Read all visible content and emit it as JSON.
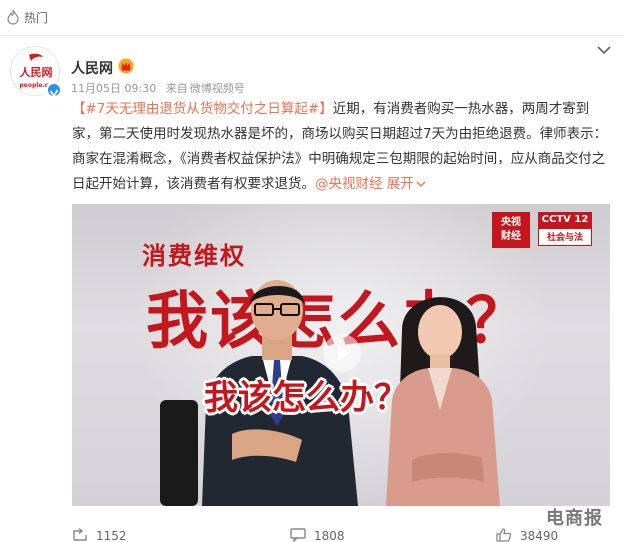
{
  "header": {
    "hot_label": "热门",
    "fire_icon": "fire-icon"
  },
  "post": {
    "author": "人民网",
    "avatar_logo_text": "人民网",
    "avatar_logo_sub": "people.cn",
    "verified_icon": "verified-icon",
    "member_icon": "crown-icon",
    "date": "11月05日 09:30",
    "source_prefix": "来自",
    "source": "微博视频号",
    "hashtag": "【#7天无理由退货从货物交付之日算起#】",
    "body": "近期，有消费者购买一热水器，两周才寄到家，第二天使用时发现热水器是坏的，商场以购买日期超过7天为由拒绝退费。律师表示：商家在混淆概念，《消费者权益保护法》中明确规定三包期限的起始时间，应从商品交付之日起开始计算，该消费者有权要求退货。",
    "mention": "@央视财经",
    "expand": "展开",
    "more_icon": "chevron-down-icon"
  },
  "video": {
    "subtitle": "消费维权",
    "title": "我该怎么办？",
    "overlay": "我该怎么办？",
    "logo_channel_line1": "央视",
    "logo_channel_line2": "财经",
    "logo_cctv12_top": "CCTV 12",
    "logo_cctv12_bottom": "社会与法",
    "play_icon": "play-icon"
  },
  "actions": {
    "forward_count": "1152",
    "comment_count": "1808",
    "like_count": "38490",
    "forward_icon": "forward-icon",
    "comment_icon": "comment-icon",
    "like_icon": "thumbs-up-icon"
  },
  "watermark": "电商报",
  "colors": {
    "accent": "#eb7350",
    "cctv_red": "#c4161c",
    "verified_blue": "#2d8ef0"
  }
}
